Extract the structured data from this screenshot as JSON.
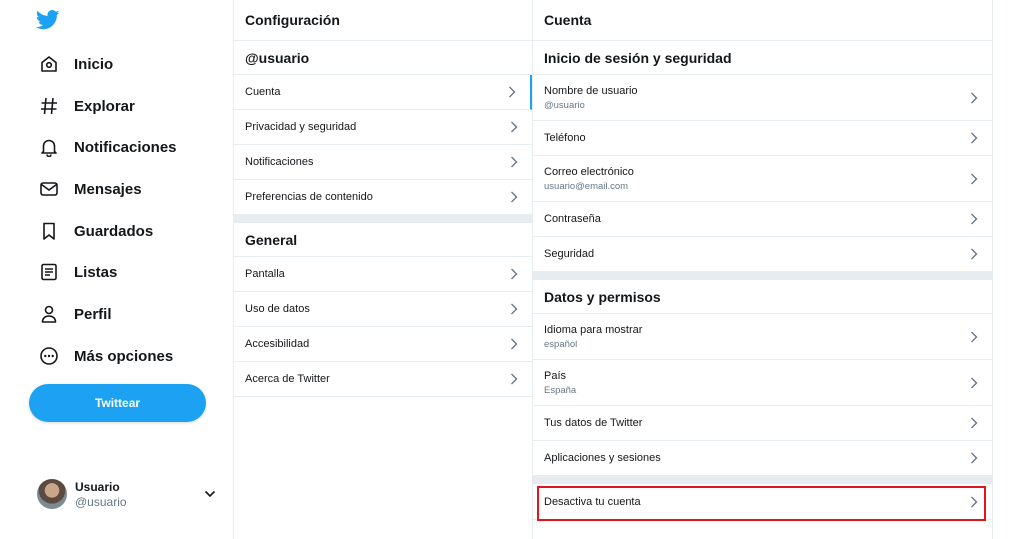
{
  "nav": {
    "logo_icon": "twitter-bird-icon",
    "items": [
      {
        "label": "Inicio",
        "icon": "home-icon"
      },
      {
        "label": "Explorar",
        "icon": "hashtag-icon"
      },
      {
        "label": "Notificaciones",
        "icon": "bell-icon"
      },
      {
        "label": "Mensajes",
        "icon": "mail-icon"
      },
      {
        "label": "Guardados",
        "icon": "bookmark-icon"
      },
      {
        "label": "Listas",
        "icon": "list-icon"
      },
      {
        "label": "Perfil",
        "icon": "user-icon"
      },
      {
        "label": "Más opciones",
        "icon": "more-icon"
      }
    ],
    "tweet_button": "Twittear",
    "account": {
      "name": "Usuario",
      "handle": "@usuario"
    }
  },
  "settings": {
    "title": "Configuración",
    "user_section": "@usuario",
    "user_items": [
      "Cuenta",
      "Privacidad y seguridad",
      "Notificaciones",
      "Preferencias de contenido"
    ],
    "general_section": "General",
    "general_items": [
      "Pantalla",
      "Uso de datos",
      "Accesibilidad",
      "Acerca de Twitter"
    ]
  },
  "account_panel": {
    "title": "Cuenta",
    "login_section": "Inicio de sesión y seguridad",
    "username_label": "Nombre de usuario",
    "username_value": "@usuario",
    "phone_label": "Teléfono",
    "email_label": "Correo electrónico",
    "email_value": "usuario@email.com",
    "password_label": "Contraseña",
    "security_label": "Seguridad",
    "data_section": "Datos y permisos",
    "language_label": "Idioma para mostrar",
    "language_value": "español",
    "country_label": "País",
    "country_value": "España",
    "twitter_data_label": "Tus datos de Twitter",
    "apps_label": "Aplicaciones y sesiones",
    "deactivate_label": "Desactiva tu cuenta"
  },
  "colors": {
    "accent": "#1da1f2",
    "highlight": "#e0161c",
    "divider": "#e6ecf0"
  }
}
